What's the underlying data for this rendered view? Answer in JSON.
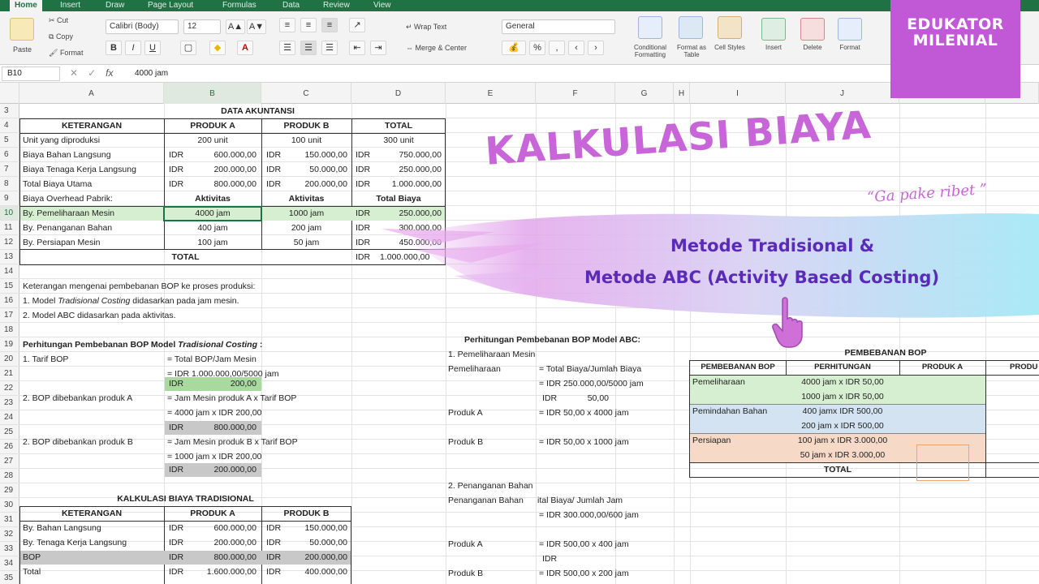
{
  "ribbon": {
    "tabs": [
      "Home",
      "Insert",
      "Draw",
      "Page Layout",
      "Formulas",
      "Data",
      "Review",
      "View"
    ],
    "clipboard": {
      "paste": "Paste",
      "cut": "Cut",
      "copy": "Copy",
      "format": "Format"
    },
    "font_name": "Calibri (Body)",
    "font_size": "12",
    "font_grow": "A▲",
    "font_shrink": "A▼",
    "bold": "B",
    "italic": "I",
    "underline": "U",
    "wrap_text": "Wrap Text",
    "merge_center": "Merge & Center",
    "number_format": "General",
    "percent": "%",
    "comma": ",",
    "conditional_formatting": "Conditional Formatting",
    "format_as_table": "Format as Table",
    "cell_styles": "Cell Styles",
    "insert": "Insert",
    "delete": "Delete",
    "format_cells": "Format"
  },
  "formula_bar": {
    "name_box": "B10",
    "fx": "fx",
    "formula": "4000 jam"
  },
  "columns": [
    "A",
    "B",
    "C",
    "D",
    "E",
    "F",
    "G",
    "H",
    "I",
    "J",
    "K",
    "L"
  ],
  "rows": [
    "3",
    "4",
    "5",
    "6",
    "7",
    "8",
    "9",
    "10",
    "11",
    "12",
    "13",
    "14",
    "15",
    "16",
    "17",
    "18",
    "19",
    "20",
    "21",
    "22",
    "23",
    "24",
    "25",
    "26",
    "27",
    "28",
    "29",
    "30",
    "31",
    "32",
    "33",
    "34",
    "35"
  ],
  "sheet": {
    "data_akuntansi": "DATA AKUNTANSI",
    "headers": [
      "KETERANGAN",
      "PRODUK A",
      "PRODUK B",
      "TOTAL"
    ],
    "r5": [
      "Unit yang diproduksi",
      "200 unit",
      "100 unit",
      "300 unit"
    ],
    "r6": [
      "Biaya Bahan Langsung",
      "IDR",
      "600.000,00",
      "IDR",
      "150.000,00",
      "IDR",
      "750.000,00"
    ],
    "r7": [
      "Biaya Tenaga Kerja Langsung",
      "IDR",
      "200.000,00",
      "IDR",
      "50.000,00",
      "IDR",
      "250.000,00"
    ],
    "r8": [
      "Total Biaya Utama",
      "IDR",
      "800.000,00",
      "IDR",
      "200.000,00",
      "IDR",
      "1.000.000,00"
    ],
    "r9": [
      "Biaya Overhead Pabrik:",
      "Aktivitas",
      "Aktivitas",
      "Total Biaya"
    ],
    "r10": [
      "By. Pemeliharaan Mesin",
      "4000 jam",
      "1000 jam",
      "IDR",
      "250.000,00"
    ],
    "r11": [
      "By. Penanganan Bahan",
      "400 jam",
      "200 jam",
      "IDR",
      "300.000,00"
    ],
    "r12": [
      "By. Persiapan Mesin",
      "100 jam",
      "50 jam",
      "IDR",
      "450.000,00"
    ],
    "r13": [
      "TOTAL",
      "IDR",
      "1.000.000,00"
    ],
    "r15": "Keterangan mengenai pembebanan BOP ke proses produksi:",
    "r16a": "1. Model ",
    "r16b": "Tradisional Costing",
    "r16c": " didasarkan pada jam mesin.",
    "r17": "2. Model ABC didasarkan pada aktivitas.",
    "r19a": "Perhitungan Pembebanan BOP Model ",
    "r19b": "Tradisional Costing",
    "r19c": " :",
    "r20": [
      "1. Tarif BOP",
      "= Total BOP/Jam Mesin"
    ],
    "r21": "= IDR 1.000.000,00/5000 jam",
    "r22": [
      "IDR",
      "200,00"
    ],
    "r23": [
      "2. BOP dibebankan produk A",
      "= Jam Mesin produk A x Tarif BOP"
    ],
    "r24": "= 4000 jam x IDR 200,00",
    "r25": [
      "IDR",
      "800.000,00"
    ],
    "r26": [
      "2. BOP dibebankan produk B",
      "= Jam Mesin produk B x Tarif BOP"
    ],
    "r27": "= 1000 jam x IDR 200,00",
    "r28": [
      "IDR",
      "200.000,00"
    ],
    "r30": "KALKULASI BIAYA TRADISIONAL",
    "r31": [
      "KETERANGAN",
      "PRODUK A",
      "PRODUK B"
    ],
    "r32": [
      "By. Bahan Langsung",
      "IDR",
      "600.000,00",
      "IDR",
      "150.000,00"
    ],
    "r33": [
      "By. Tenaga Kerja Langsung",
      "IDR",
      "200.000,00",
      "IDR",
      "50.000,00"
    ],
    "r34": [
      "BOP",
      "IDR",
      "800.000,00",
      "IDR",
      "200.000,00"
    ],
    "r35": [
      "Total",
      "IDR",
      "1.600.000,00",
      "IDR",
      "400.000,00"
    ],
    "abc_title": "Perhitungan Pembebanan BOP Model ABC:",
    "abc20": "1. Pemeliharaan Mesin",
    "abc21": [
      "Pemeliharaan",
      "= Total Biaya/Jumlah Biaya"
    ],
    "abc22": "= IDR 250.000,00/5000 jam",
    "abc23": [
      "IDR",
      "50,00"
    ],
    "abc24": [
      "Produk A",
      "= IDR 50,00 x 4000 jam"
    ],
    "abc26": [
      "Produk B",
      "= IDR 50,00 x 1000 jam"
    ],
    "abc29": "2. Penanganan Bahan",
    "abc30": [
      "Penanganan Bahan",
      "ital Biaya/ Jumlah Jam"
    ],
    "abc31": "= IDR 300.000,00/600 jam",
    "abc33": [
      "Produk A",
      "= IDR 500,00 x 400 jam"
    ],
    "abc34": "IDR",
    "abc35": [
      "Produk B",
      "= IDR 500,00 x 200 jam"
    ],
    "pb_title": "PEMBEBANAN BOP",
    "pb_headers": [
      "PEMBEBANAN BOP",
      "PERHITUNGAN",
      "PRODUK A",
      "PRODU"
    ],
    "pb_rows": [
      [
        "Pemeliharaan",
        "4000 jam x IDR 50,00"
      ],
      [
        "",
        "1000 jam x IDR 50,00"
      ],
      [
        "Pemindahan Bahan",
        "400 jamx IDR 500,00"
      ],
      [
        "",
        "200 jam x IDR 500,00"
      ],
      [
        "Persiapan",
        "100 jam x IDR 3.000,00"
      ],
      [
        "",
        "50 jam x IDR 3.000,00"
      ]
    ],
    "pb_total": "TOTAL"
  },
  "overlay": {
    "logo_line1": "EDUKATOR",
    "logo_line2": "MILENIAL",
    "title": "KALKULASI BIAYA",
    "subtitle": "“Ga pake  ribet ”",
    "method_line1": "Metode Tradisional &",
    "method_line2": "Metode ABC (Activity Based Costing)"
  },
  "colors": {
    "excel_green": "#1f7244",
    "highlight_green": "#d6efd0",
    "highlight_gray": "#c8c8c8",
    "highlight_blue": "#d3e3f1",
    "highlight_peach": "#f6d9c6",
    "brand_purple": "#c159d6",
    "text_purple": "#5a2ab8"
  }
}
